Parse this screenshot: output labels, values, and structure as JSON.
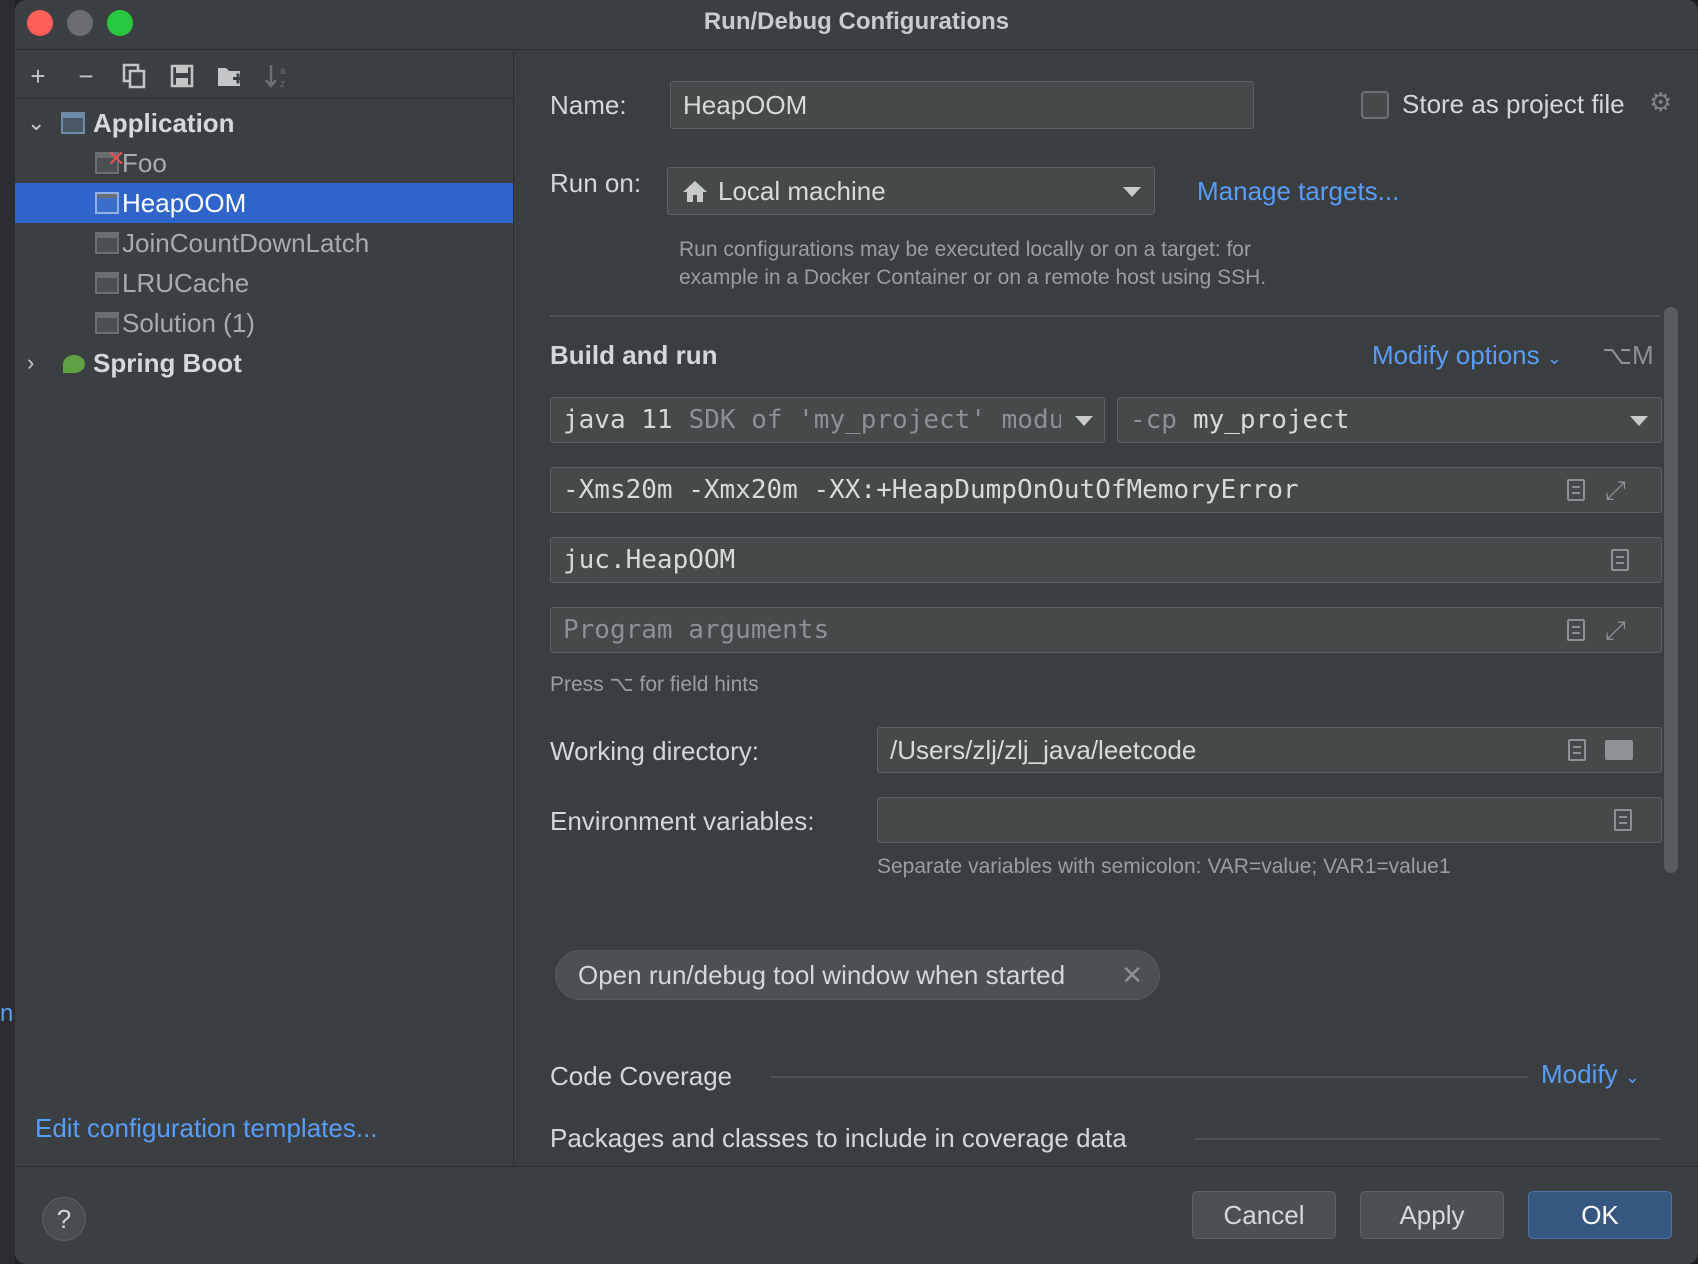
{
  "window": {
    "title": "Run/Debug Configurations"
  },
  "toolbar": {
    "add_icon": "+",
    "remove_icon": "−",
    "copy_icon": "copy-icon",
    "save_icon": "save-icon",
    "folder_icon": "new-folder-icon",
    "sort_icon": "sort-icon"
  },
  "tree": {
    "groups": [
      {
        "label": "Application",
        "expanded": true,
        "children": [
          {
            "label": "Foo",
            "error": true
          },
          {
            "label": "HeapOOM",
            "selected": true
          },
          {
            "label": "JoinCountDownLatch"
          },
          {
            "label": "LRUCache"
          },
          {
            "label": "Solution (1)"
          }
        ]
      },
      {
        "label": "Spring Boot",
        "expanded": false
      }
    ]
  },
  "left_footer": {
    "edit_templates": "Edit configuration templates..."
  },
  "form": {
    "name_label": "Name:",
    "name_value": "HeapOOM",
    "store_label": "Store as project file",
    "run_on_label": "Run on:",
    "run_on_value": "Local machine",
    "manage_targets": "Manage targets...",
    "run_on_hint_1": "Run configurations may be executed locally or on a target: for",
    "run_on_hint_2": "example in a Docker Container or on a remote host using SSH.",
    "build_and_run": "Build and run",
    "modify_options": "Modify options",
    "modify_shortcut": "⌥M",
    "jdk_value": "java 11",
    "jdk_hint": "SDK of 'my_project' modu",
    "cp_prefix": "-cp",
    "cp_value": "my_project",
    "vm_options": "-Xms20m -Xmx20m -XX:+HeapDumpOnOutOfMemoryError",
    "main_class": "juc.HeapOOM",
    "program_args_placeholder": "Program arguments",
    "field_hints": "Press ⌥ for field hints",
    "working_dir_label": "Working directory:",
    "working_dir_value": "/Users/zlj/zlj_java/leetcode",
    "env_label": "Environment variables:",
    "env_value": "",
    "env_hint": "Separate variables with semicolon: VAR=value; VAR1=value1",
    "chip_label": "Open run/debug tool window when started",
    "code_coverage": "Code Coverage",
    "modify": "Modify",
    "packages_label": "Packages and classes to include in coverage data"
  },
  "buttons": {
    "help": "?",
    "cancel": "Cancel",
    "apply": "Apply",
    "ok": "OK"
  },
  "colors": {
    "selection": "#2f65ca",
    "link": "#589df6",
    "primary_button": "#365880",
    "close": "#ff5f57",
    "zoom": "#28c840"
  }
}
